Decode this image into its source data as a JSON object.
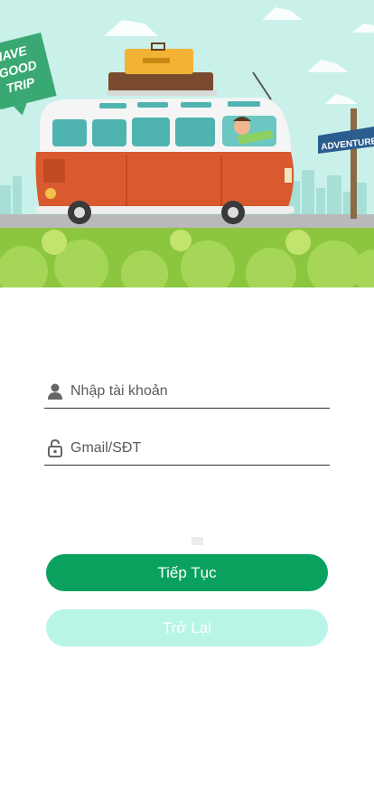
{
  "hero": {
    "sign_left": [
      "HAVE",
      "GOOD",
      "TRIP"
    ],
    "sign_right": "ADVENTURE"
  },
  "form": {
    "username_placeholder": "Nhập tài khoản",
    "contact_placeholder": "Gmail/SĐT"
  },
  "actions": {
    "continue_label": "Tiếp Tục",
    "back_label": "Trở Lại"
  },
  "colors": {
    "primary": "#0aa15f",
    "secondary": "#b8f5e6",
    "sky": "#c7f0e8",
    "grass": "#8cc63f"
  },
  "icons": {
    "username": "person-icon",
    "contact": "lock-open-icon"
  }
}
